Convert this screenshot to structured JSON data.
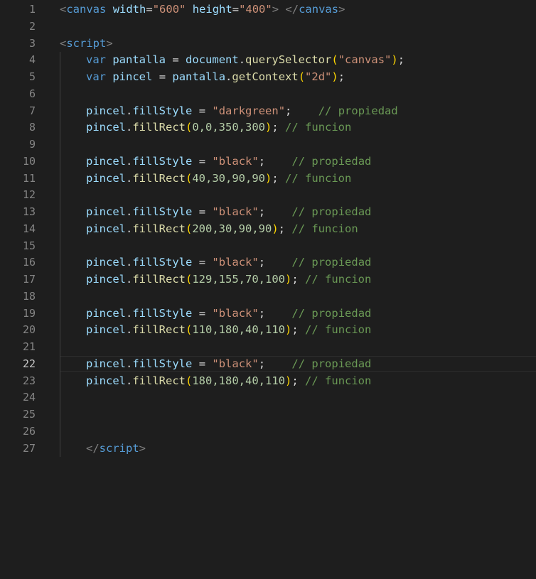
{
  "line_numbers": [
    "1",
    "2",
    "3",
    "4",
    "5",
    "6",
    "7",
    "8",
    "9",
    "10",
    "11",
    "12",
    "13",
    "14",
    "15",
    "16",
    "17",
    "18",
    "19",
    "20",
    "21",
    "22",
    "23",
    "24",
    "25",
    "26",
    "27"
  ],
  "active_line": "22",
  "code": {
    "l1": {
      "tag_open": "<",
      "tag": "canvas",
      "attr1": "width",
      "val1": "\"600\"",
      "attr2": "height",
      "val2": "\"400\"",
      "close": ">",
      "end_open": "</",
      "end_tag": "canvas",
      "end_close": ">"
    },
    "l3": {
      "open": "<",
      "tag": "script",
      "close": ">"
    },
    "l4": {
      "kw": "var",
      "name": "pantalla",
      "obj": "document",
      "method": "querySelector",
      "arg": "\"canvas\""
    },
    "l5": {
      "kw": "var",
      "name": "pincel",
      "obj": "pantalla",
      "method": "getContext",
      "arg": "\"2d\""
    },
    "l7": {
      "obj": "pincel",
      "prop": "fillStyle",
      "value": "\"darkgreen\"",
      "comment": "// propiedad"
    },
    "l8": {
      "obj": "pincel",
      "method": "fillRect",
      "args": "0,0,350,300",
      "comment": "// funcion"
    },
    "l10": {
      "obj": "pincel",
      "prop": "fillStyle",
      "value": "\"black\"",
      "comment": "// propiedad"
    },
    "l11": {
      "obj": "pincel",
      "method": "fillRect",
      "args": "40,30,90,90",
      "comment": "// funcion"
    },
    "l13": {
      "obj": "pincel",
      "prop": "fillStyle",
      "value": "\"black\"",
      "comment": "// propiedad"
    },
    "l14": {
      "obj": "pincel",
      "method": "fillRect",
      "args": "200,30,90,90",
      "comment": "// funcion"
    },
    "l16": {
      "obj": "pincel",
      "prop": "fillStyle",
      "value": "\"black\"",
      "comment": "// propiedad"
    },
    "l17": {
      "obj": "pincel",
      "method": "fillRect",
      "args": "129,155,70,100",
      "comment": "// funcion"
    },
    "l19": {
      "obj": "pincel",
      "prop": "fillStyle",
      "value": "\"black\"",
      "comment": "// propiedad"
    },
    "l20": {
      "obj": "pincel",
      "method": "fillRect",
      "args": "110,180,40,110",
      "comment": "// funcion"
    },
    "l22": {
      "obj": "pincel",
      "prop": "fillStyle",
      "value": "\"black\"",
      "comment": "// propiedad"
    },
    "l23": {
      "obj": "pincel",
      "method": "fillRect",
      "args": "180,180,40,110",
      "comment": "// funcion"
    },
    "l27": {
      "open": "</",
      "tag": "script",
      "close": ">"
    }
  },
  "colors": {
    "background": "#1e1e1e",
    "keyword": "#569cd6",
    "string": "#ce9178",
    "variable": "#9cdcfe",
    "function": "#dcdcaa",
    "comment": "#6a9955",
    "line_number": "#858585"
  }
}
